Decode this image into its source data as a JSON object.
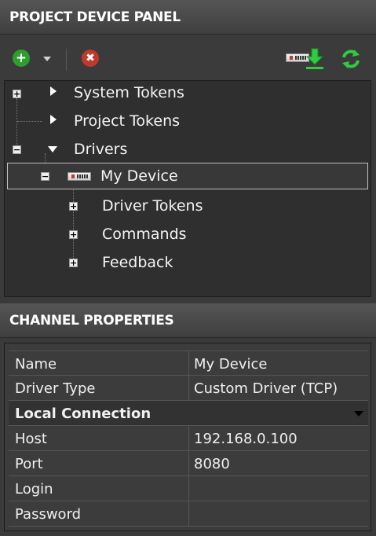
{
  "device_panel": {
    "title": "PROJECT DEVICE PANEL",
    "toolbar": {
      "add_icon": "plus-circle-icon",
      "add_dropdown_icon": "chevron-down-icon",
      "delete_icon": "x-circle-icon",
      "device_icon": "device-icon",
      "download_icon": "download-arrow-icon",
      "refresh_icon": "refresh-icon",
      "colors": {
        "add": "#2e9e2e",
        "delete": "#c0392b",
        "download": "#2ecc40",
        "refresh": "#2ecc40"
      }
    },
    "tree": {
      "system_tokens": "System Tokens",
      "project_tokens": "Project Tokens",
      "drivers": "Drivers",
      "my_device": "My Device",
      "driver_tokens": "Driver Tokens",
      "commands": "Commands",
      "feedback": "Feedback"
    }
  },
  "channel_properties": {
    "title": "CHANNEL PROPERTIES",
    "rows": [
      {
        "key": "Name",
        "value": "My Device"
      },
      {
        "key": "Driver Type",
        "value": "Custom Driver (TCP)"
      }
    ],
    "section": "Local Connection",
    "connection_rows": [
      {
        "key": "Host",
        "value": "192.168.0.100"
      },
      {
        "key": "Port",
        "value": "8080"
      },
      {
        "key": "Login",
        "value": ""
      },
      {
        "key": "Password",
        "value": ""
      }
    ]
  }
}
